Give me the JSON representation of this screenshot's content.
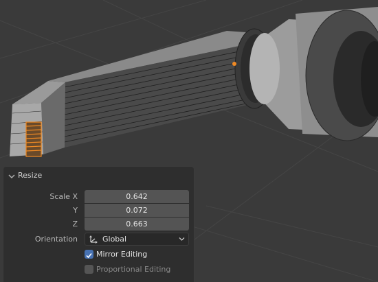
{
  "colors": {
    "viewport_bg": "#3a3a3a",
    "panel_bg": "#2e2e2e",
    "field_bg": "#545454",
    "selection_orange": "#f08a24",
    "checkbox_on": "#4772b3"
  },
  "panel": {
    "title": "Resize",
    "scale": [
      {
        "label": "Scale X",
        "value": "0.642"
      },
      {
        "label": "Y",
        "value": "0.072"
      },
      {
        "label": "Z",
        "value": "0.663"
      }
    ],
    "orientation": {
      "label": "Orientation",
      "value": "Global",
      "icon": "orientation-axes-icon"
    },
    "mirror": {
      "label": "Mirror Editing",
      "checked": true
    },
    "proportional": {
      "label": "Proportional Editing",
      "checked": false
    }
  }
}
